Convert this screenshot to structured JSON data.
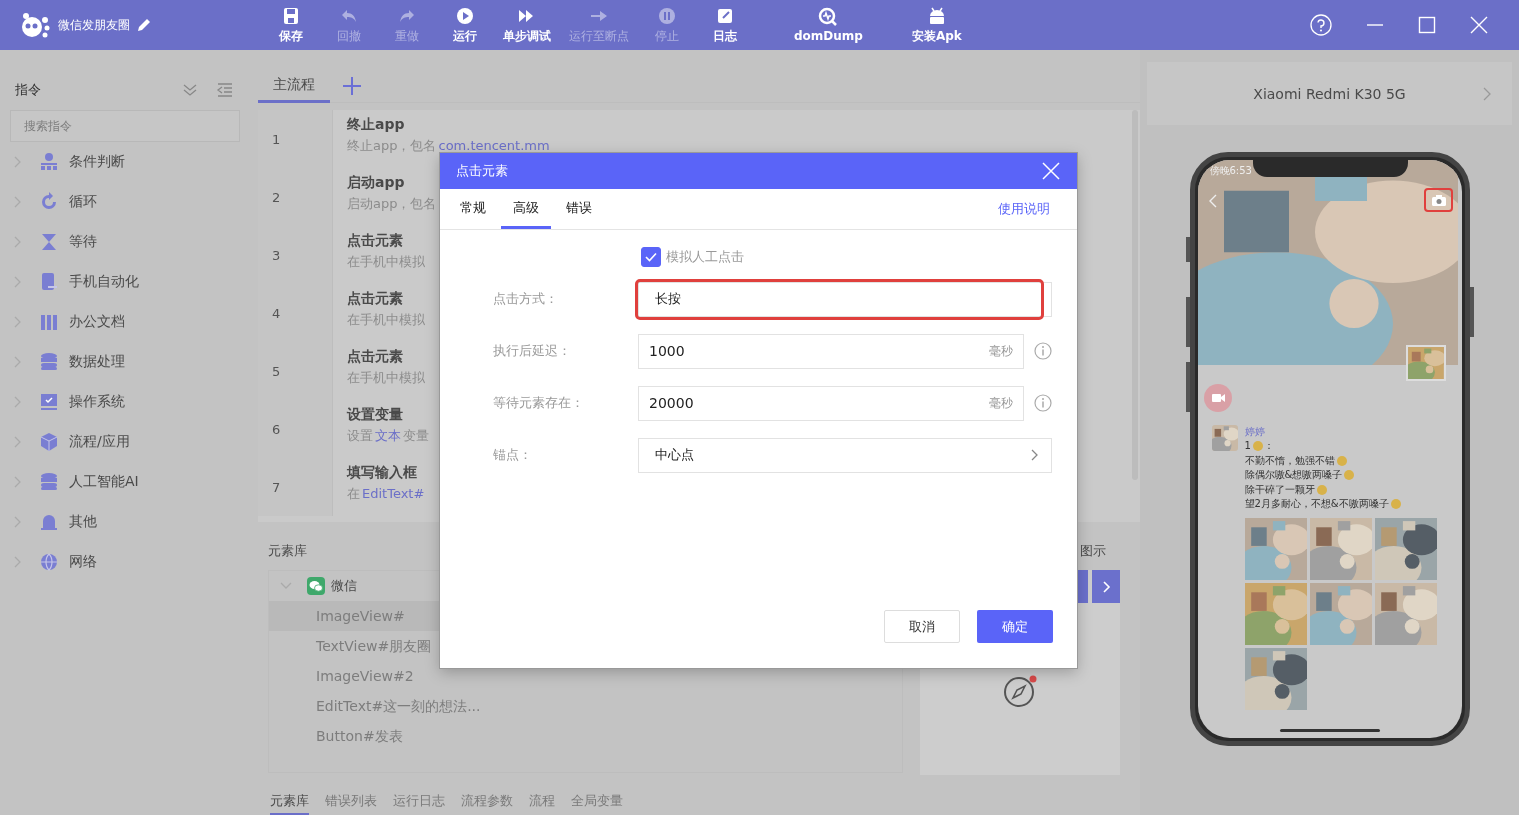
{
  "app": {
    "title": "微信发朋友圈"
  },
  "toolbar": [
    {
      "label": "保存",
      "disabled": false
    },
    {
      "label": "回撤",
      "disabled": true
    },
    {
      "label": "重做",
      "disabled": true
    },
    {
      "label": "运行",
      "disabled": false
    },
    {
      "label": "单步调试",
      "disabled": false
    },
    {
      "label": "运行至断点",
      "disabled": true
    },
    {
      "label": "停止",
      "disabled": true
    },
    {
      "label": "日志",
      "disabled": false
    },
    {
      "label": "domDump",
      "disabled": false
    },
    {
      "label": "安装Apk",
      "disabled": false
    }
  ],
  "sidebar": {
    "title": "指令",
    "search_placeholder": "搜索指令",
    "items": [
      {
        "label": "条件判断"
      },
      {
        "label": "循环"
      },
      {
        "label": "等待"
      },
      {
        "label": "手机自动化"
      },
      {
        "label": "办公文档"
      },
      {
        "label": "数据处理"
      },
      {
        "label": "操作系统"
      },
      {
        "label": "流程/应用"
      },
      {
        "label": "人工智能AI"
      },
      {
        "label": "其他"
      },
      {
        "label": "网络"
      }
    ]
  },
  "flow": {
    "tabs": [
      {
        "label": "主流程",
        "selected": true
      }
    ],
    "steps": [
      {
        "number": "1",
        "title": "终止app",
        "desc": [
          {
            "text": "终止app，包名",
            "link": false
          },
          {
            "text": "com.tencent.mm",
            "link": true
          }
        ]
      },
      {
        "number": "2",
        "title": "启动app",
        "desc": [
          {
            "text": "启动app，包名",
            "link": false
          }
        ]
      },
      {
        "number": "3",
        "title": "点击元素",
        "desc": [
          {
            "text": "在手机中模拟",
            "link": false
          }
        ]
      },
      {
        "number": "4",
        "title": "点击元素",
        "desc": [
          {
            "text": "在手机中模拟",
            "link": false
          }
        ]
      },
      {
        "number": "5",
        "title": "点击元素",
        "desc": [
          {
            "text": "在手机中模拟",
            "link": false
          }
        ]
      },
      {
        "number": "6",
        "title": "设置变量",
        "desc": [
          {
            "text": "设置",
            "link": false
          },
          {
            "text": "文本",
            "link": true
          },
          {
            "text": "变量",
            "link": false
          }
        ]
      },
      {
        "number": "7",
        "title": "填写输入框",
        "desc": [
          {
            "text": "在",
            "link": false
          },
          {
            "text": "EditText#",
            "link": true
          }
        ]
      }
    ]
  },
  "element_library": {
    "title": "元素库",
    "groups": [
      {
        "label": "微信",
        "expanded": true,
        "children": [
          {
            "label": "ImageView#",
            "selected": true
          },
          {
            "label": "TextView#朋友圈",
            "selected": false
          },
          {
            "label": "ImageView#2",
            "selected": false
          },
          {
            "label": "EditText#这一刻的想法...",
            "selected": false
          },
          {
            "label": "Button#发表",
            "selected": false
          }
        ]
      }
    ]
  },
  "preview": {
    "title": "图示"
  },
  "bottom_tabs": [
    {
      "label": "元素库",
      "selected": true
    },
    {
      "label": "错误列表",
      "selected": false
    },
    {
      "label": "运行日志",
      "selected": false
    },
    {
      "label": "流程参数",
      "selected": false
    },
    {
      "label": "流程",
      "selected": false
    },
    {
      "label": "全局变量",
      "selected": false
    }
  ],
  "device": {
    "name": "Xiaomi Redmi K30 5G",
    "screen": {
      "status_time": "傍晚6:53",
      "camera_highlighted": true,
      "post": {
        "author": "婷婷",
        "lines": [
          {
            "text": "1",
            "emoji": true,
            "after": "："
          },
          {
            "text": "不勤不惰，勉强不错",
            "emoji": true
          },
          {
            "text": "除偶尔嗷&想嗷两嗓子",
            "emoji": true
          },
          {
            "text": "除干碎了一颗牙",
            "emoji": true
          },
          {
            "text": "望2月多耐心，不想&不嗷两嗓子",
            "emoji": true
          }
        ]
      }
    }
  },
  "dialog": {
    "title": "点击元素",
    "tabs": [
      {
        "label": "常规",
        "selected": false
      },
      {
        "label": "高级",
        "selected": true
      },
      {
        "label": "错误",
        "selected": false
      }
    ],
    "help_link": "使用说明",
    "checkbox": {
      "label": "模拟人工点击",
      "checked": true
    },
    "fields": [
      {
        "kind": "select",
        "label": "点击方式：",
        "value": "长按",
        "highlighted": true
      },
      {
        "kind": "number",
        "label": "执行后延迟：",
        "value": "1000",
        "unit": "毫秒",
        "highlighted": false
      },
      {
        "kind": "number",
        "label": "等待元素存在：",
        "value": "20000",
        "unit": "毫秒",
        "highlighted": false
      },
      {
        "kind": "select",
        "label": "锚点：",
        "value": "中心点",
        "highlighted": false
      }
    ],
    "buttons": [
      {
        "label": "取消",
        "kind": "secondary"
      },
      {
        "label": "确定",
        "kind": "primary"
      }
    ]
  }
}
